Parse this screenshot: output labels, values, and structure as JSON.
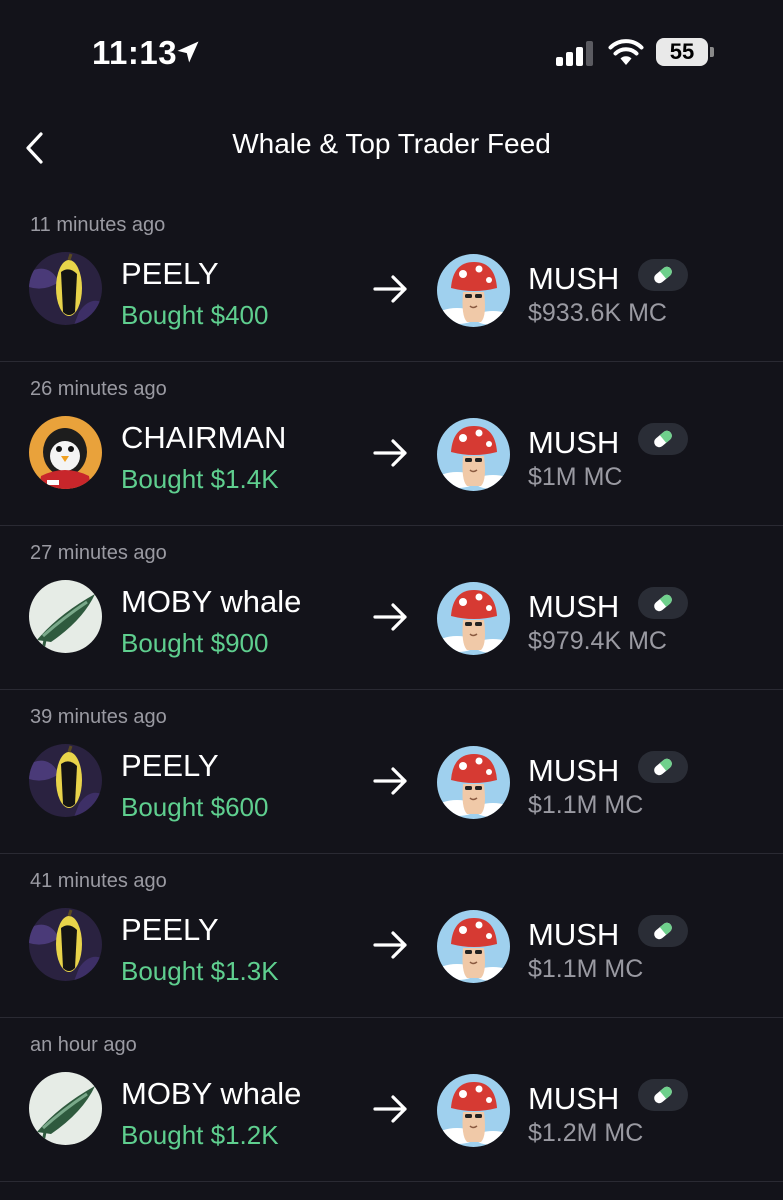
{
  "status_bar": {
    "time": "11:13",
    "battery": "55"
  },
  "header": {
    "title": "Whale & Top Trader Feed"
  },
  "colors": {
    "background": "#13131a",
    "buy_green": "#5fcf8f",
    "muted_text": "#9a9aa2",
    "divider": "#2a2a33"
  },
  "feed": [
    {
      "time": "11 minutes ago",
      "trader": "PEELY",
      "avatar": "peely",
      "action": "Bought $400",
      "token": "MUSH",
      "market_cap": "$933.6K MC"
    },
    {
      "time": "26 minutes ago",
      "trader": "CHAIRMAN",
      "avatar": "penguin",
      "action": "Bought $1.4K",
      "token": "MUSH",
      "market_cap": "$1M MC"
    },
    {
      "time": "27 minutes ago",
      "trader": "MOBY whale",
      "avatar": "moby",
      "action": "Bought $900",
      "token": "MUSH",
      "market_cap": "$979.4K MC"
    },
    {
      "time": "39 minutes ago",
      "trader": "PEELY",
      "avatar": "peely",
      "action": "Bought $600",
      "token": "MUSH",
      "market_cap": "$1.1M MC"
    },
    {
      "time": "41 minutes ago",
      "trader": "PEELY",
      "avatar": "peely",
      "action": "Bought $1.3K",
      "token": "MUSH",
      "market_cap": "$1.1M MC"
    },
    {
      "time": "an hour ago",
      "trader": "MOBY whale",
      "avatar": "moby",
      "action": "Bought $1.2K",
      "token": "MUSH",
      "market_cap": "$1.2M MC"
    }
  ]
}
